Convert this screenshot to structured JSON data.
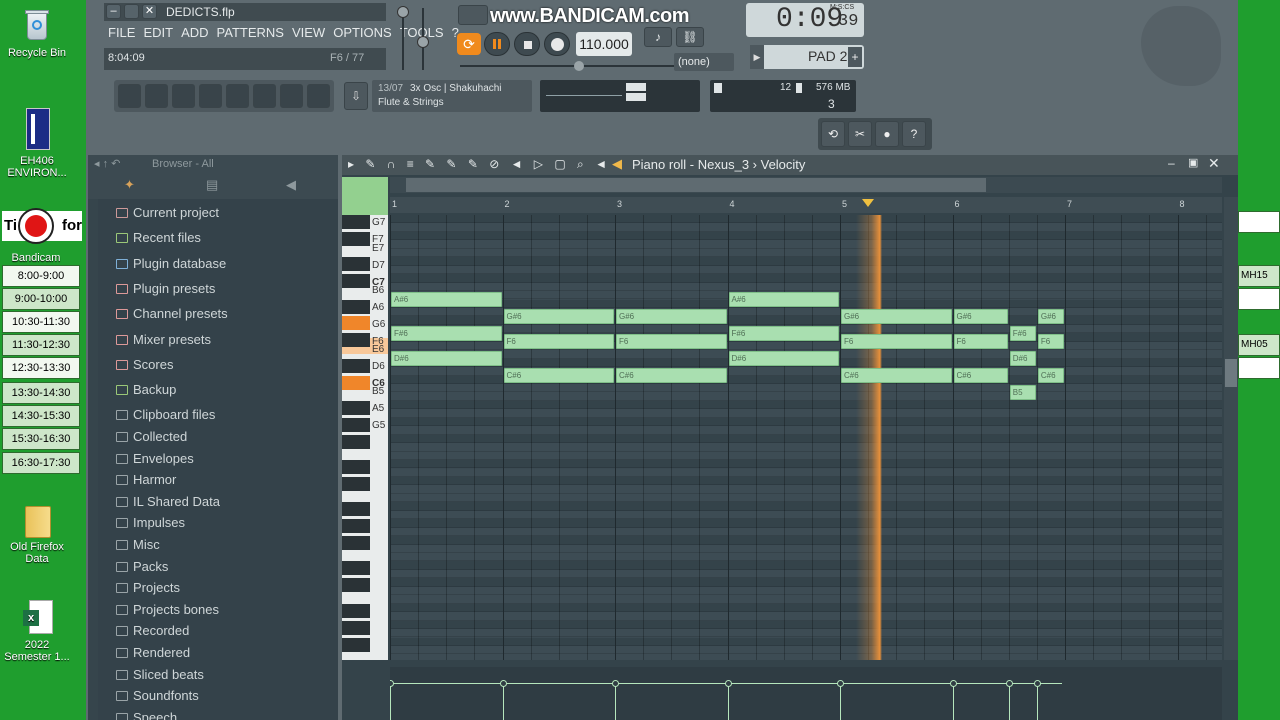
{
  "desktop": {
    "icons": [
      {
        "id": "recycle",
        "label": "Recycle Bin"
      },
      {
        "id": "eh406",
        "label": "EH406 ENVIRON..."
      },
      {
        "id": "bandicam",
        "label": "Bandicam"
      },
      {
        "id": "firefox",
        "label": "Old Firefox Data"
      },
      {
        "id": "excel",
        "label": "2022 Semester 1..."
      }
    ],
    "banner_text": "Ti",
    "banner_text2": "for",
    "schedule": [
      "8:00-9:00",
      "9:00-10:00",
      "10:30-11:30",
      "11:30-12:30",
      "12:30-13:30",
      "13:30-14:30",
      "14:30-15:30",
      "15:30-16:30",
      "16:30-17:30"
    ],
    "right_cells": [
      "MH15",
      "MH05"
    ]
  },
  "fl": {
    "file_name": "DEDICTS.flp",
    "menu": [
      "FILE",
      "EDIT",
      "ADD",
      "PATTERNS",
      "VIEW",
      "OPTIONS",
      "TOOLS",
      "?"
    ],
    "hint_time": "8:04:09",
    "hint_right": "F6 / 77",
    "tempo": "110.000",
    "time_main": "0:09",
    "time_small": "39",
    "time_unit": "M:S:CS",
    "watermark": "www.BANDICAM.com",
    "none_label": "(none)",
    "pad_label": "PAD 2",
    "channel_num": "13/07",
    "channel_name": "3x Osc | Shakuhachi",
    "channel_sub": "Flute & Strings",
    "cpu_value": "12",
    "mem_value": "576 MB",
    "poly_value": "3",
    "browser_title": "Browser - All",
    "browser_items": [
      {
        "label": "Current project"
      },
      {
        "label": "Recent files"
      },
      {
        "label": "Plugin database"
      },
      {
        "label": "Plugin presets"
      },
      {
        "label": "Channel presets"
      },
      {
        "label": "Mixer presets"
      },
      {
        "label": "Scores"
      },
      {
        "label": "Backup"
      },
      {
        "label": "Clipboard files"
      },
      {
        "label": "Collected"
      },
      {
        "label": "Envelopes"
      },
      {
        "label": "Harmor"
      },
      {
        "label": "IL Shared Data"
      },
      {
        "label": "Impulses"
      },
      {
        "label": "Misc"
      },
      {
        "label": "Packs"
      },
      {
        "label": "Projects"
      },
      {
        "label": "Projects bones"
      },
      {
        "label": "Recorded"
      },
      {
        "label": "Rendered"
      },
      {
        "label": "Sliced beats"
      },
      {
        "label": "Soundfonts"
      },
      {
        "label": "Speech"
      }
    ],
    "piano_roll_title": "Piano roll - Nexus_3 › Velocity",
    "bar_numbers": [
      "1",
      "2",
      "3",
      "4",
      "5",
      "6",
      "7",
      "8"
    ],
    "key_labels": [
      "G7",
      "F7",
      "E7",
      "D7",
      "C7",
      "B6",
      "A6",
      "G6",
      "F6",
      "E6",
      "D6",
      "C6",
      "B5",
      "A5",
      "G5"
    ],
    "notes": [
      {
        "pitch": "A#6",
        "start": 1,
        "length": 1
      },
      {
        "pitch": "A#6",
        "start": 4,
        "length": 1
      },
      {
        "pitch": "G#6",
        "start": 2,
        "length": 1
      },
      {
        "pitch": "G#6",
        "start": 3,
        "length": 1
      },
      {
        "pitch": "G#6",
        "start": 5,
        "length": 1
      },
      {
        "pitch": "G#6",
        "start": 6,
        "length": 0.5
      },
      {
        "pitch": "G#6",
        "start": 6.75,
        "length": 0.25
      },
      {
        "pitch": "F#6",
        "start": 1,
        "length": 1
      },
      {
        "pitch": "F#6",
        "start": 4,
        "length": 1
      },
      {
        "pitch": "F#6",
        "start": 6.5,
        "length": 0.25
      },
      {
        "pitch": "F6",
        "start": 2,
        "length": 1
      },
      {
        "pitch": "F6",
        "start": 3,
        "length": 1
      },
      {
        "pitch": "F6",
        "start": 5,
        "length": 1
      },
      {
        "pitch": "F6",
        "start": 6,
        "length": 0.5
      },
      {
        "pitch": "F6",
        "start": 6.75,
        "length": 0.25
      },
      {
        "pitch": "D#6",
        "start": 1,
        "length": 1
      },
      {
        "pitch": "D#6",
        "start": 4,
        "length": 1
      },
      {
        "pitch": "D#6",
        "start": 6.5,
        "length": 0.25
      },
      {
        "pitch": "C#6",
        "start": 2,
        "length": 1
      },
      {
        "pitch": "C#6",
        "start": 3,
        "length": 1
      },
      {
        "pitch": "C#6",
        "start": 5,
        "length": 1
      },
      {
        "pitch": "C#6",
        "start": 6,
        "length": 0.5
      },
      {
        "pitch": "C#6",
        "start": 6.75,
        "length": 0.25
      },
      {
        "pitch": "B5",
        "start": 6.5,
        "length": 0.25
      }
    ],
    "playhead_bar": 5.25
  }
}
